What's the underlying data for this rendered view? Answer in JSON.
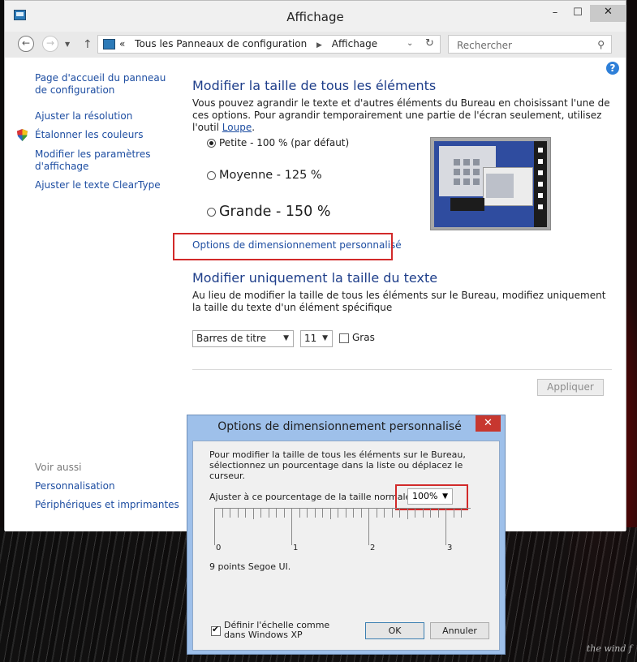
{
  "window": {
    "title": "Affichage",
    "minimize_glyph": "–",
    "maximize_glyph": "☐",
    "close_glyph": "✕"
  },
  "nav": {
    "back_glyph": "←",
    "forward_glyph": "→",
    "up_glyph": "↑",
    "address_prefix": "«",
    "breadcrumb": [
      "Tous les Panneaux de configuration",
      "Affichage"
    ],
    "search_placeholder": "Rechercher"
  },
  "icons": {
    "app": "monitor-icon",
    "help": "help-icon",
    "shield": "shield-icon",
    "search": "search-icon"
  },
  "sidebar": {
    "home": "Page d'accueil du panneau de configuration",
    "resolution": "Ajuster la résolution",
    "calibrate": "Étalonner les couleurs",
    "params": "Modifier les paramètres d'affichage",
    "cleartype": "Ajuster le texte ClearType",
    "see_also": "Voir aussi",
    "personalization": "Personnalisation",
    "peripherals": "Périphériques et imprimantes"
  },
  "main": {
    "heading_all": "Modifier la taille de tous les éléments",
    "para_all_1": "Vous pouvez agrandir le texte et d'autres éléments du Bureau en choisissant l'une de ces options. Pour agrandir temporairement une partie de l'écran seulement, utilisez l'outil ",
    "loupe_link": "Loupe",
    "para_all_end": ".",
    "radio_small": "Petite - 100 % (par défaut)",
    "radio_medium": "Moyenne - 125 %",
    "radio_large": "Grande - 150 %",
    "selected_option": "Petite - 100 % (par défaut)",
    "custom_link": "Options de dimensionnement personnalisé",
    "heading_text": "Modifier uniquement la taille du texte",
    "para_text": "Au lieu de modifier la taille de tous les éléments sur le Bureau, modifiez uniquement la taille du texte d'un élément spécifique",
    "element_select": "Barres de titre",
    "size_select": "11",
    "bold_label": "Gras",
    "bold_checked": false,
    "apply_button": "Appliquer"
  },
  "dialog": {
    "title": "Options de dimensionnement personnalisé",
    "close_glyph": "✕",
    "instructions": "Pour modifier la taille de tous les éléments sur le Bureau, sélectionnez un pourcentage dans la liste ou déplacez le curseur.",
    "scale_label": "Ajuster à ce pourcentage de la taille normale :",
    "scale_value": "100%",
    "ruler_labels": [
      "0",
      "1",
      "2",
      "3"
    ],
    "font_info": "9 points Segoe UI.",
    "winxp_label": "Définir l'échelle comme dans Windows XP",
    "winxp_checked": true,
    "ok_button": "OK",
    "cancel_button": "Annuler"
  },
  "wallpaper": {
    "text": "the wind f"
  },
  "colors": {
    "link": "#1d4da1",
    "heading": "#1e3e8a",
    "highlight": "#d22a2a",
    "dialog_frame": "#9ec0ea",
    "close_red": "#c7372f"
  }
}
